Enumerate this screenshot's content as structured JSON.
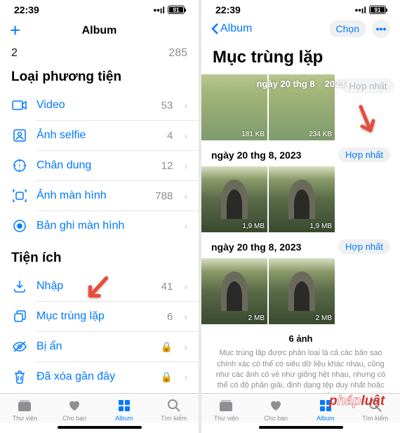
{
  "statusbar": {
    "time": "22:39",
    "battery": "91"
  },
  "left": {
    "nav_title": "Album",
    "truncated": {
      "num": "2",
      "count": "285"
    },
    "section_media": "Loại phương tiện",
    "section_util": "Tiện ích",
    "media_rows": [
      {
        "label": "Video",
        "count": "53"
      },
      {
        "label": "Ảnh selfie",
        "count": "4"
      },
      {
        "label": "Chân dung",
        "count": "12"
      },
      {
        "label": "Ảnh màn hình",
        "count": "788"
      },
      {
        "label": "Bản ghi màn hình",
        "count": ""
      }
    ],
    "util_rows": [
      {
        "label": "Nhập",
        "count": "41"
      },
      {
        "label": "Mục trùng lặp",
        "count": "6"
      },
      {
        "label": "Bị ẩn",
        "count": ""
      },
      {
        "label": "Đã xóa gần đây",
        "count": ""
      }
    ],
    "tabs": [
      "Thư viện",
      "Cho bạn",
      "Album",
      "Tìm kiếm"
    ]
  },
  "right": {
    "back": "Album",
    "choose": "Chọn",
    "title": "Mục trùng lặp",
    "merge": "Hợp nhất",
    "groups": [
      {
        "date_a": "ngày 20 thg 8",
        "date_b": "2023",
        "size_a": "181 KB",
        "size_b": "234 KB",
        "type": "lotus"
      },
      {
        "date": "ngày 20 thg 8, 2023",
        "size_a": "1,9 MB",
        "size_b": "1,9 MB",
        "type": "gate"
      },
      {
        "date": "ngày 20 thg 8, 2023",
        "size_a": "2 MB",
        "size_b": "2 MB",
        "type": "gate"
      }
    ],
    "footer_count": "6 ảnh",
    "footer_text": "Mục trùng lặp được phân loại là cả các bản sao chính xác có thể có siêu dữ liệu khác nhau, cũng như các ảnh có vẻ như giống hệt nhau, nhưng có thể có độ phân giải, định dạng tệp duy nhất hoặc có những khác biệt nhỏ khác.",
    "tabs": [
      "Thư viện",
      "Cho bạn",
      "Album",
      "Tìm kiếm"
    ]
  }
}
